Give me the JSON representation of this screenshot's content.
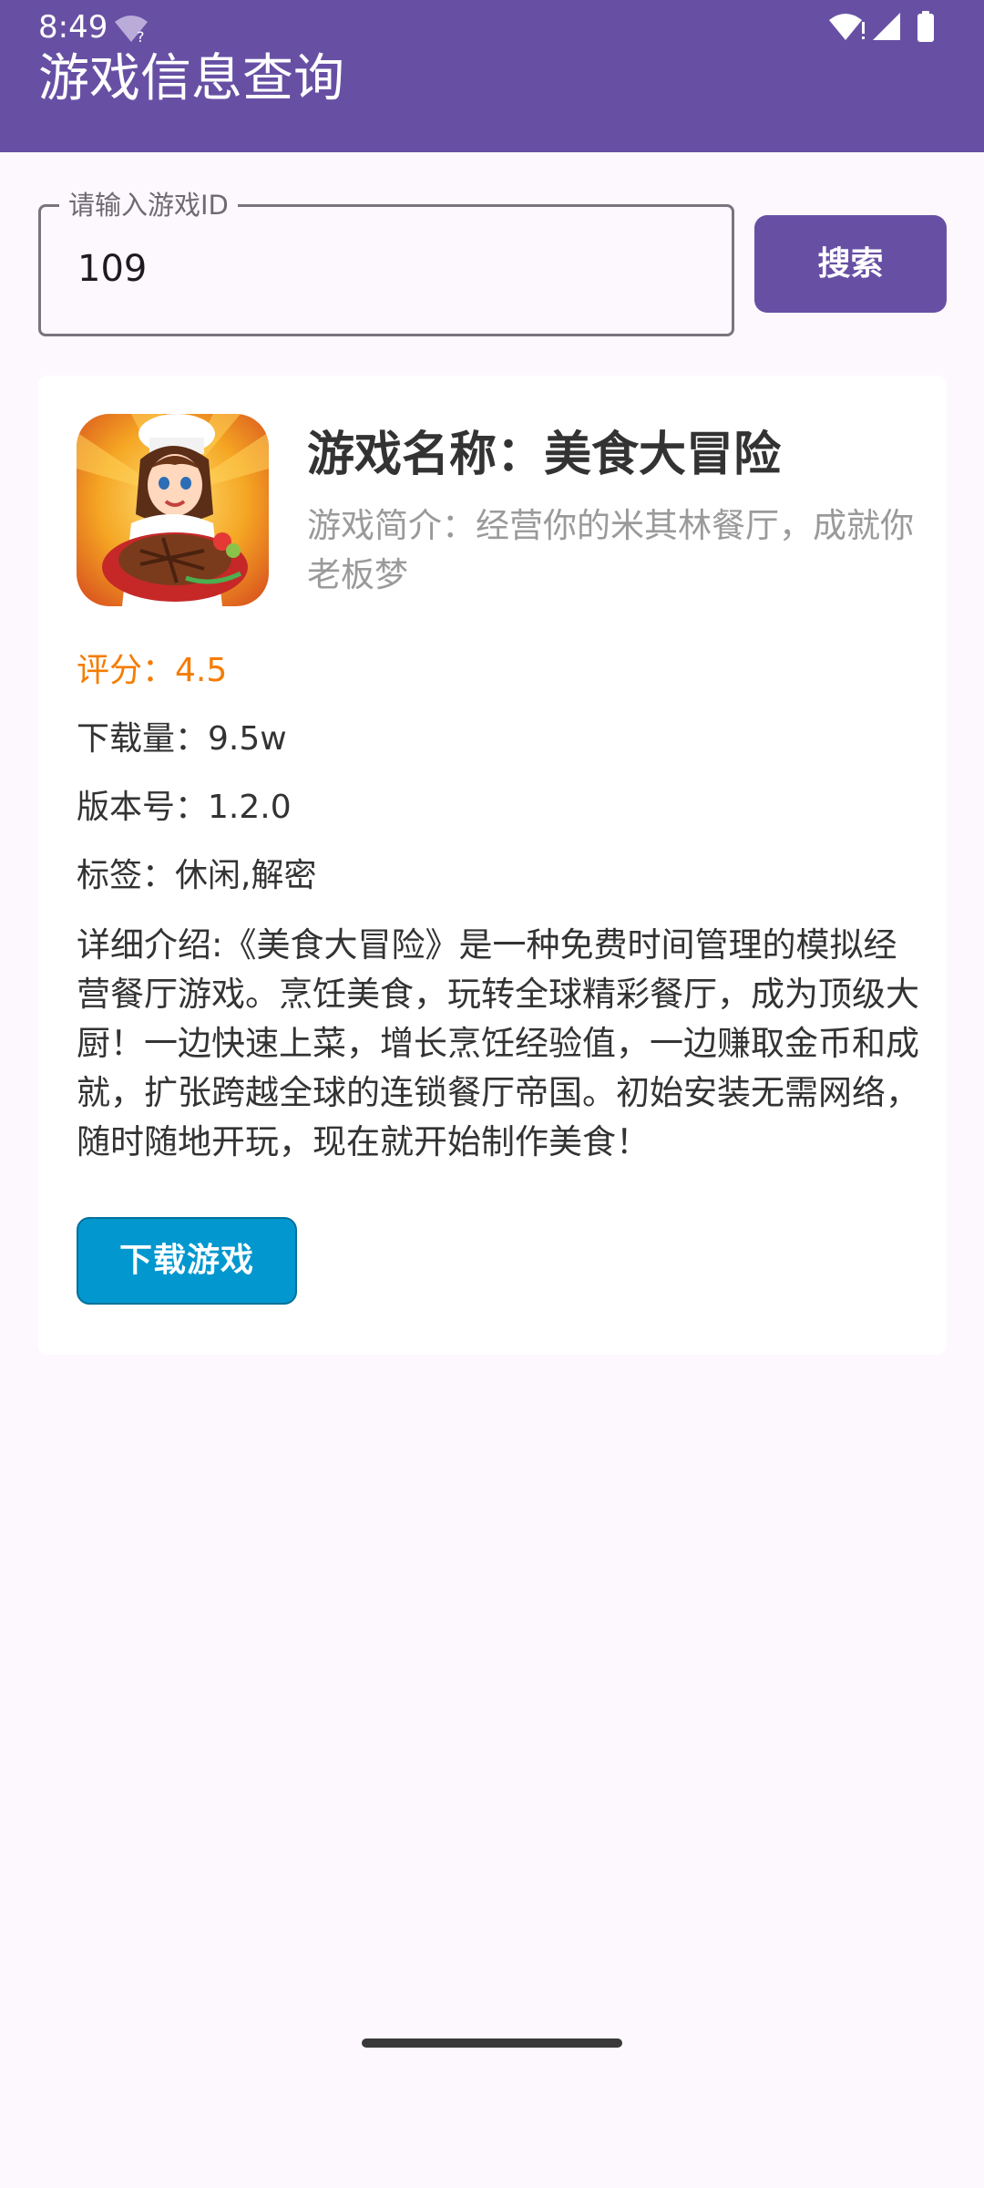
{
  "status_bar": {
    "time": "8:49",
    "wifi_q_icon": "wifi-question-icon",
    "icons": [
      "wifi-alert-icon",
      "signal-icon",
      "battery-icon"
    ]
  },
  "app_bar": {
    "title": "游戏信息查询",
    "color": "#6750a4"
  },
  "search": {
    "label": "请输入游戏ID",
    "value": "109",
    "button_label": "搜索"
  },
  "game": {
    "icon": "chef-game-icon",
    "name": "游戏名称：美食大冒险",
    "summary": "游戏简介：经营你的米其林餐厅，成就你老板梦",
    "rating": "评分：4.5",
    "downloads": "下载量：9.5w",
    "version": "版本号：1.2.0",
    "tags": "标签：休闲,解密",
    "details": "详细介绍:《美食大冒险》是一种免费时间管理的模拟经营餐厅游戏。烹饪美食，玩转全球精彩餐厅，成为顶级大厨！一边快速上菜，增长烹饪经验值，一边赚取金币和成就，扩张跨越全球的连锁餐厅帝国。初始安装无需网络，随时随地开玩，现在就开始制作美食！",
    "download_button": "下载游戏",
    "rating_color": "#f57c00",
    "download_color": "#0297cf"
  }
}
